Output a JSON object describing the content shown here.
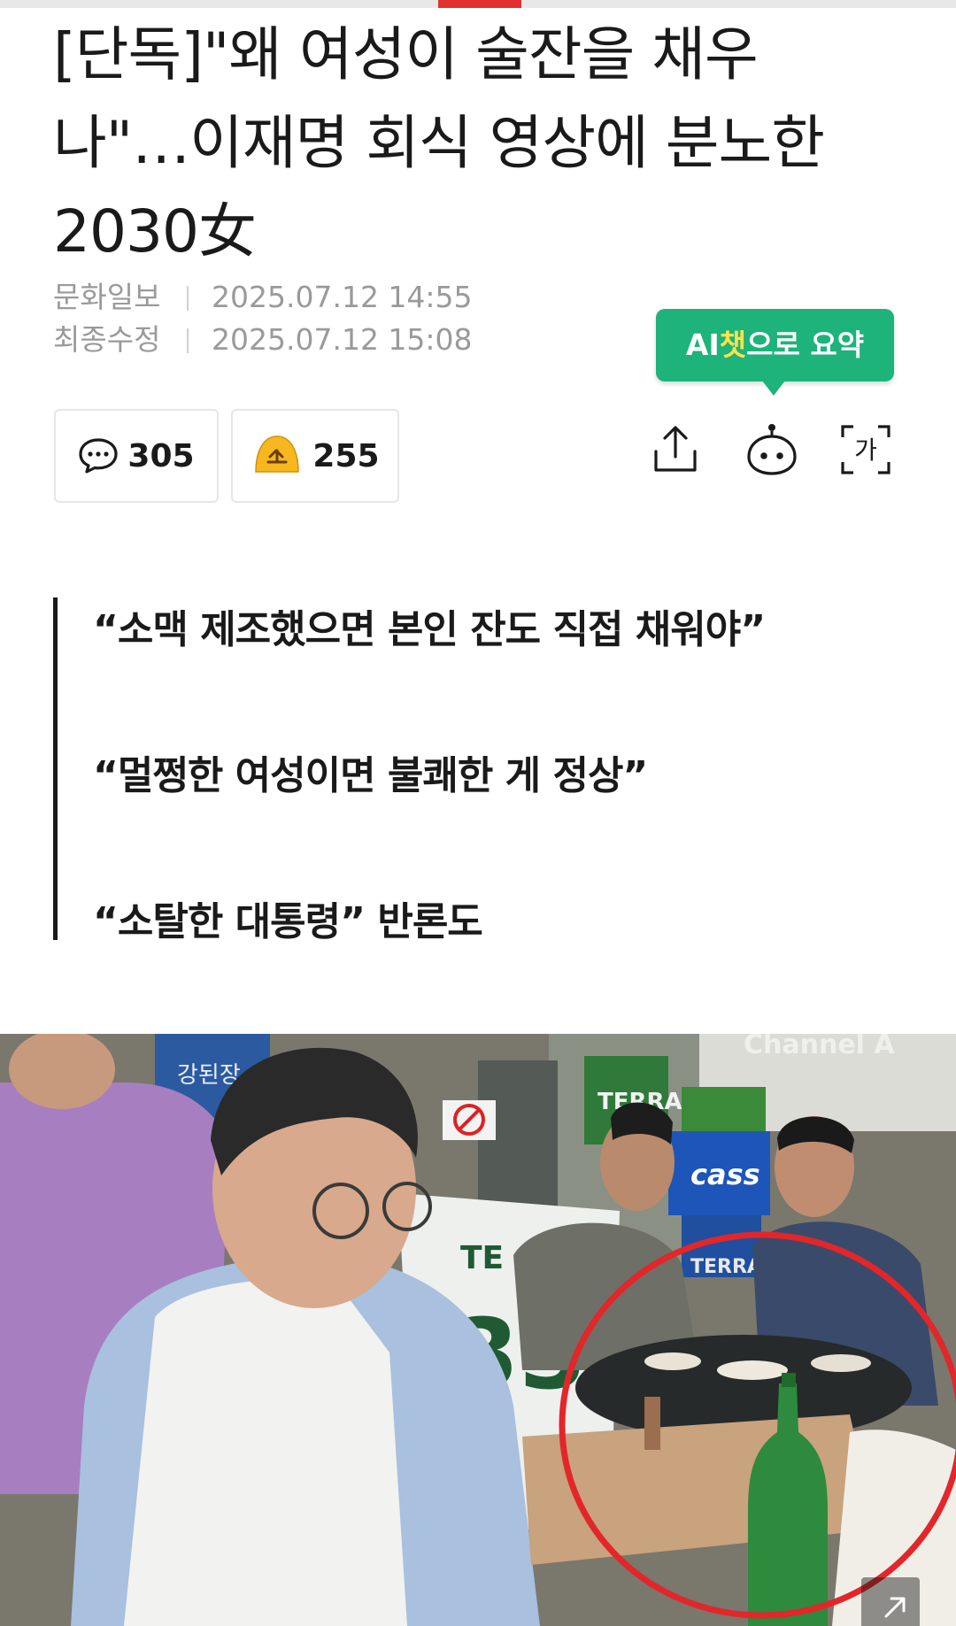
{
  "article": {
    "headline_line1": "[단독]\"왜 여성이 술잔을 채우",
    "headline_line2": "나\"…이재명 회식 영상에 분노한",
    "headline_line3": "2030女",
    "publisher": "문화일보",
    "published_at": "2025.07.12 14:55",
    "modified_label": "최종수정",
    "modified_at": "2025.07.12 15:08"
  },
  "ai_summary": {
    "label_prefix": "AI",
    "label_highlight": "챗",
    "label_suffix": "으로 요약"
  },
  "stats": {
    "comments": "305",
    "reactions": "255"
  },
  "actions": {
    "font_icon_glyph": "가"
  },
  "quotes": [
    "“소맥 제조했으면 본인 잔도 직접 채워야”",
    "“멀쩡한 여성이면 불쾌한 게 정상”",
    "“소탈한 대통령” 반론도"
  ],
  "photo": {
    "watermark": "Channel A",
    "sign_text": "강된장",
    "crate_brand_1": "TERRA",
    "crate_brand_2": "cass",
    "crate_brand_3": "TERRA",
    "jersey_number": "33",
    "jersey_letters": "TE"
  },
  "colors": {
    "accent_red": "#e0312f",
    "ai_green": "#1db37a",
    "ai_highlight": "#ffe14a",
    "reaction_yellow": "#f7b81f"
  },
  "icons": [
    "comment-icon",
    "reaction-face-icon",
    "share-icon",
    "ai-bot-icon",
    "font-size-icon",
    "expand-icon"
  ]
}
